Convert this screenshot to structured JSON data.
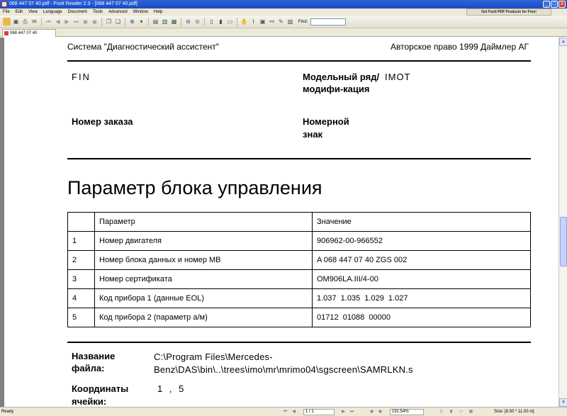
{
  "window": {
    "title": "068 447 07 40.pdf - Foxit Reader 2.3 - [068 447 07 40.pdf]",
    "controls": [
      "_",
      "□",
      "x"
    ]
  },
  "menu": {
    "items": [
      "File",
      "Edit",
      "View",
      "Language",
      "Document",
      "Tools",
      "Advanced",
      "Window",
      "Help"
    ],
    "promo": "Get Foxit PDF Products for Free!"
  },
  "toolbar": {
    "find_label": "Find:",
    "find_value": ""
  },
  "tabs": [
    {
      "label": "068 447 07 40"
    }
  ],
  "document": {
    "header_left": "Система \"Диагностический ассистент\"",
    "header_right": "Авторское право 1999 Даймлер АГ",
    "fin_label": "FIN",
    "model_label": "Модельный ряд/модифи-кация",
    "model_value": "IMOT",
    "order_label": "Номер заказа",
    "plate_label": "Номерной знак",
    "section_title": "Параметр блока управления",
    "table": {
      "headers": [
        "",
        "Параметр",
        "Значение"
      ],
      "rows": [
        [
          "1",
          "Номер двигателя",
          "906962-00-966552"
        ],
        [
          "2",
          "Номер блока данных и номер MB",
          "A 068 447 07 40 ZGS 002"
        ],
        [
          "3",
          "Номер сертификата",
          "OM906LA.III/4-00"
        ],
        [
          "4",
          "Код прибора 1 (данные EOL)",
          "1.037  1.035  1.029  1.027"
        ],
        [
          "5",
          "Код прибора 2 (параметр а/м)",
          "01712  01088  00000"
        ]
      ]
    },
    "filename_label": "Название файла:",
    "filename_value": "C:\\Program Files\\Mercedes-Benz\\DAS\\bin\\..\\trees\\imo\\mr\\mrimo04\\sgscreen\\SAMRLKN.s",
    "coord_label": "Координаты ячейки:",
    "coord_value": "1 , 5"
  },
  "status": {
    "ready": "Ready",
    "page_box": "1 / 1",
    "zoom_box": "191.54%",
    "size": "Size: [8.50 * 11.00 in]"
  }
}
